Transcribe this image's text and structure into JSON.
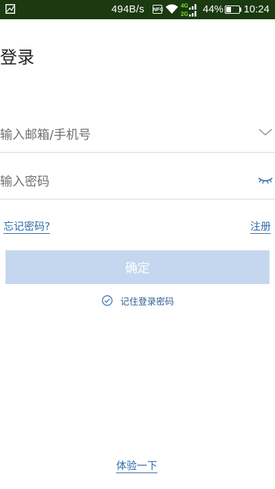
{
  "status_bar": {
    "net_speed": "494B/s",
    "nfc_label": "NFC",
    "network_4g": "4G",
    "network_2g": "2G",
    "battery_percent": "44%",
    "battery_level": 0.44,
    "time": "10:24",
    "left_icon": "image-icon",
    "background_color": "#1b3a10"
  },
  "page": {
    "title": "登录"
  },
  "form": {
    "email_placeholder": "输入邮箱/手机号",
    "email_value": "",
    "password_placeholder": "输入密码",
    "password_value": "",
    "email_icon": "chevron-down-icon",
    "password_icon": "eye-closed-icon"
  },
  "links": {
    "forgot_password": "忘记密码?",
    "register": "注册",
    "try_it": "体验一下"
  },
  "actions": {
    "confirm_label": "确定",
    "confirm_color": "#c4d7ef"
  },
  "remember": {
    "label": "记住登录密码",
    "checked": true
  },
  "colors": {
    "accent": "#2c6aa8",
    "divider": "#d8d8d8"
  }
}
